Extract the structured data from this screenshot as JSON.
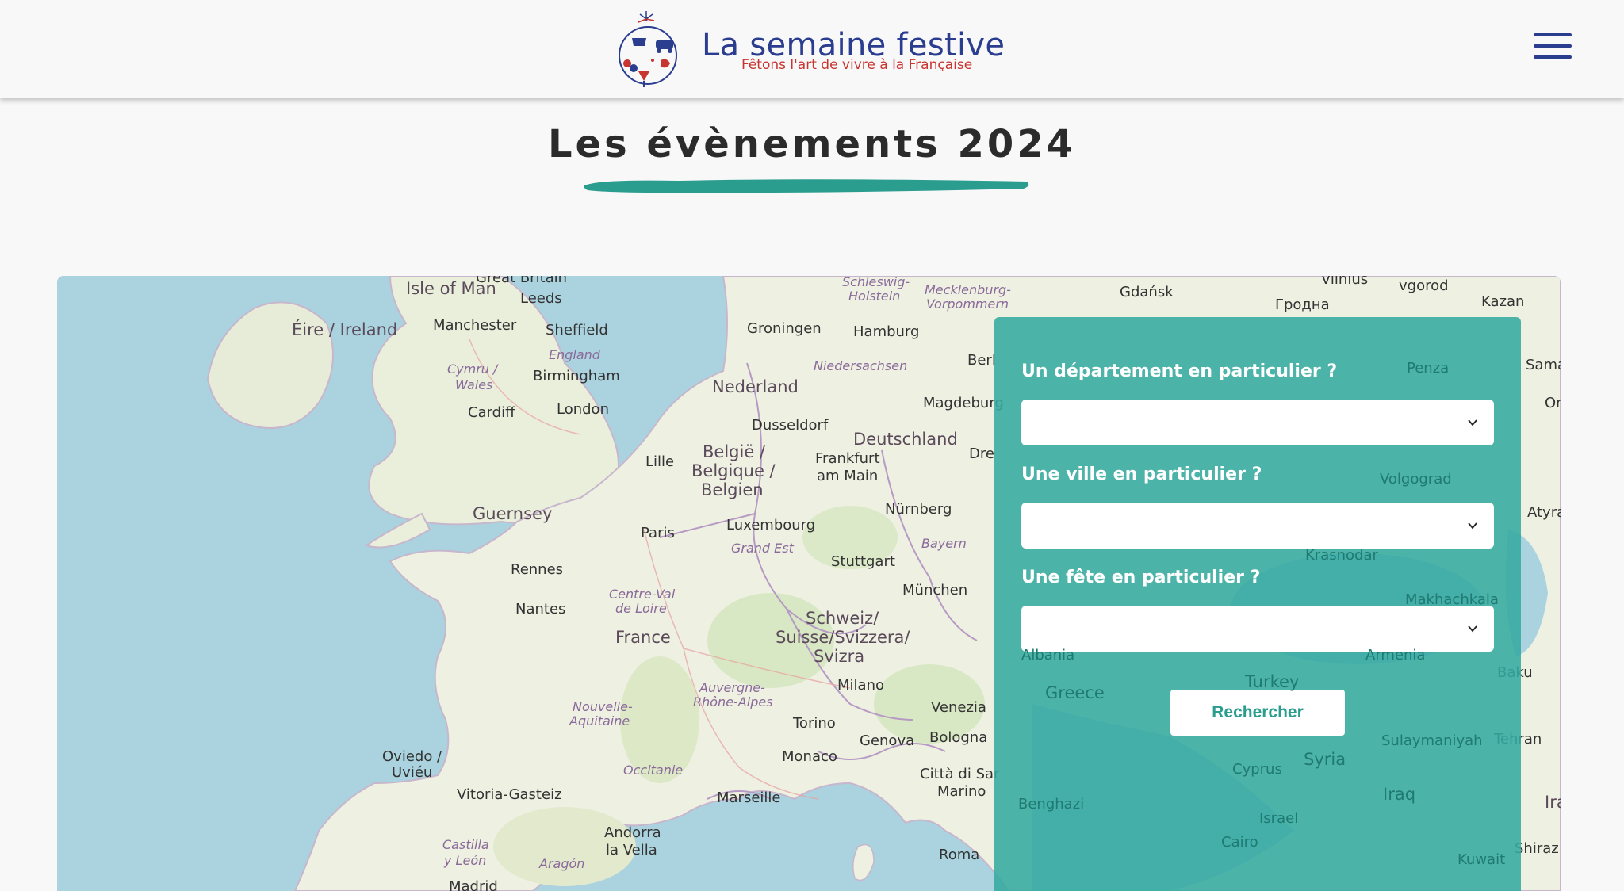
{
  "header": {
    "logo_title": "La semaine festive",
    "logo_tagline": "Fêtons l'art de vivre à la Française",
    "menu_icon": "hamburger-menu-icon"
  },
  "page": {
    "title": "Les évènements 2024"
  },
  "colors": {
    "brand_blue": "#2a3d8f",
    "brand_red": "#c8342f",
    "accent_teal": "#36aaa0",
    "title_text": "#2b2b2b"
  },
  "map": {
    "labels": {
      "isle_of_man": "Isle of Man",
      "great_britain": "Great Britain",
      "eire": "Éire / Ireland",
      "leeds": "Leeds",
      "manchester": "Manchester",
      "sheffield": "Sheffield",
      "england": "England",
      "cymru": "Cymru /",
      "wales": "Wales",
      "birmingham": "Birmingham",
      "cardiff": "Cardiff",
      "london": "London",
      "guernsey": "Guernsey",
      "groningen": "Groningen",
      "hamburg": "Hamburg",
      "schleswig": "Schleswig-",
      "holstein": "Holstein",
      "mecklenburg": "Mecklenburg-",
      "vorpommern": "Vorpommern",
      "niedersachsen": "Niedersachsen",
      "berlin": "Berl",
      "nederland": "Nederland",
      "magdeburg": "Magdeburg",
      "dusseldorf": "Dusseldorf",
      "deutschland": "Deutschland",
      "dresden": "Dre",
      "belgie1": "België /",
      "belgie2": "Belgique /",
      "belgie3": "Belgien",
      "lille": "Lille",
      "frankfurt": "Frankfurt",
      "am_main": "am Main",
      "luxembourg": "Luxembourg",
      "nurnberg": "Nürnberg",
      "grand_est": "Grand Est",
      "bayern": "Bayern",
      "paris": "Paris",
      "stuttgart": "Stuttgart",
      "rennes": "Rennes",
      "munchen": "München",
      "centre1": "Centre-Val",
      "centre2": "de Loire",
      "nantes": "Nantes",
      "schweiz1": "Schweiz/",
      "schweiz2": "Suisse/Svizzera/",
      "schweiz3": "Svizra",
      "france": "France",
      "milano": "Milano",
      "auvergne1": "Auvergne-",
      "auvergne2": "Rhône-Alpes",
      "nouvelle1": "Nouvelle-",
      "nouvelle2": "Aquitaine",
      "venezia": "Venezia",
      "torino": "Torino",
      "genova": "Genova",
      "bologna": "Bologna",
      "oviedo1": "Oviedo /",
      "oviedo2": "Uviéu",
      "monaco": "Monaco",
      "occitanie": "Occitanie",
      "citta1": "Città di Sar",
      "citta2": "Marino",
      "vitoria": "Vitoria-Gasteiz",
      "marseille": "Marseille",
      "andorra1": "Andorra",
      "andorra2": "la Vella",
      "castilla1": "Castilla",
      "castilla2": "y León",
      "aragon": "Aragón",
      "madrid": "Madrid",
      "roma": "Roma",
      "gdansk": "Gdańsk",
      "vilnius": "Vilnius",
      "grodno": "Гродна",
      "novgorod": "vgorod",
      "kazan": "Kazan",
      "penza": "Penza",
      "samara": "Samara",
      "oren": "Ore",
      "volgograd": "Volgograd",
      "atyrau": "Atyrau",
      "krasnodar": "Krasnodar",
      "makhachkala": "Makhachkala",
      "armenia": "Armenia",
      "baku": "Baku",
      "turkey": "Turkey",
      "greece": "Greece",
      "albania": "Albania",
      "syria": "Syria",
      "cyprus": "Cyprus",
      "sulaymaniyah": "Sulaymaniyah",
      "tehran": "Tehran",
      "iraq": "Iraq",
      "iran": "Ira",
      "benghazi": "Benghazi",
      "israel": "Israel",
      "cairo": "Cairo",
      "kuwait": "Kuwait",
      "shiraz": "Shiraz"
    }
  },
  "search": {
    "department_label": "Un département en particulier ?",
    "department_value": "",
    "city_label": "Une ville en particulier ?",
    "city_value": "",
    "fete_label": "Une fête en particulier ?",
    "fete_value": "",
    "submit_label": "Rechercher"
  }
}
